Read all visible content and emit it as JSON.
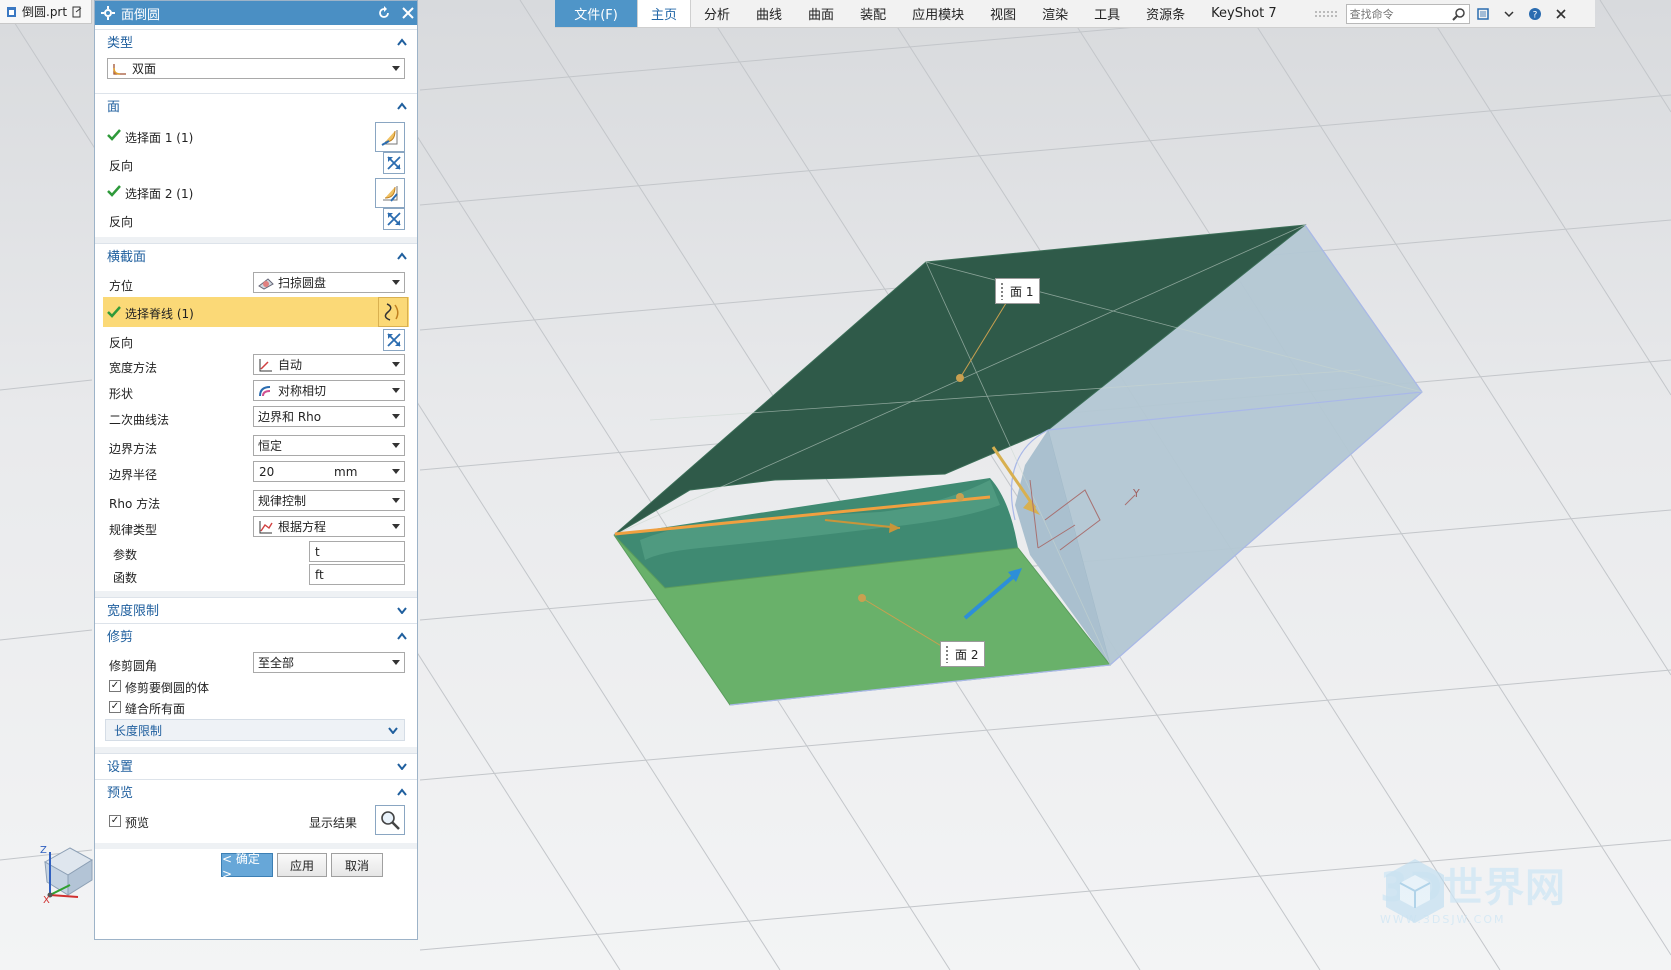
{
  "document": {
    "filename": "倒圆.prt"
  },
  "ribbon": {
    "file_tab": "文件(F)",
    "tabs": [
      "主页",
      "分析",
      "曲线",
      "曲面",
      "装配",
      "应用模块",
      "视图",
      "渲染",
      "工具",
      "资源条",
      "KeyShot 7"
    ],
    "active_tab": "主页",
    "search_placeholder": "查找命令"
  },
  "dialog": {
    "title": "面倒圆",
    "type": {
      "heading": "类型",
      "value": "双面"
    },
    "faces": {
      "heading": "面",
      "select_face_1": "选择面 1 (1)",
      "reverse_1": "反向",
      "select_face_2": "选择面 2 (1)",
      "reverse_2": "反向"
    },
    "cross_section": {
      "heading": "横截面",
      "orientation_label": "方位",
      "orientation_value": "扫掠圆盘",
      "select_spine": "选择脊线 (1)",
      "reverse": "反向",
      "width_method_label": "宽度方法",
      "width_method_value": "自动",
      "shape_label": "形状",
      "shape_value": "对称相切",
      "conic_method_label": "二次曲线法",
      "conic_method_value": "边界和 Rho",
      "boundary_method_label": "边界方法",
      "boundary_method_value": "恒定",
      "boundary_radius_label": "边界半径",
      "boundary_radius_value": "20",
      "boundary_radius_unit": "mm",
      "rho_method_label": "Rho 方法",
      "rho_method_value": "规律控制",
      "law_type_label": "规律类型",
      "law_type_value": "根据方程",
      "param_label": "参数",
      "param_value": "t",
      "function_label": "函数",
      "function_value": "ft"
    },
    "width_limit": {
      "heading": "宽度限制"
    },
    "trim": {
      "heading": "修剪",
      "trim_fillet_label": "修剪圆角",
      "trim_fillet_value": "至全部",
      "trim_body_label": "修剪要倒圆的体",
      "sew_faces_label": "缝合所有面",
      "length_limit": "长度限制"
    },
    "settings": {
      "heading": "设置"
    },
    "preview": {
      "heading": "预览",
      "preview_label": "预览",
      "show_result_label": "显示结果"
    },
    "buttons": {
      "ok": "< 确定 >",
      "apply": "应用",
      "cancel": "取消"
    }
  },
  "viewport": {
    "callout_face1": "面 1",
    "callout_face2": "面 2",
    "triad_z": "Z",
    "triad_x": "X",
    "csys_y": "Y"
  },
  "watermark": {
    "title": "3D世界网",
    "url": "WWW.3DSJW.COM"
  }
}
